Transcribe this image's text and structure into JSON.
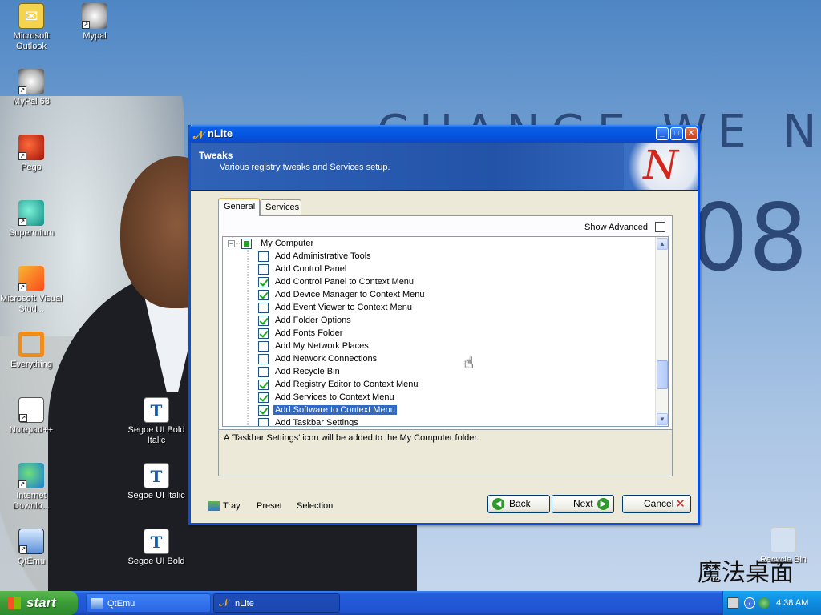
{
  "desktop": {
    "wallpaper_text": "CHANGE WE NEED",
    "wallpaper_year": "08",
    "brand_script": "魔法桌面",
    "icons_left": [
      {
        "label": "Microsoft Outlook",
        "icon": "outlook-icon"
      },
      {
        "label": "MyPal 68",
        "icon": "mypal-icon"
      },
      {
        "label": "Pego",
        "icon": "pego-icon"
      },
      {
        "label": "Supermium",
        "icon": "supermium-icon"
      },
      {
        "label": "Microsoft Visual Stud...",
        "icon": "visual-studio-icon"
      },
      {
        "label": "Everything",
        "icon": "everything-icon"
      },
      {
        "label": "Notepad++",
        "icon": "notepad-plus-plus-icon"
      },
      {
        "label": "Internet Downlo...",
        "icon": "idm-icon"
      },
      {
        "label": "QtEmu",
        "icon": "qtemu-icon"
      }
    ],
    "icons_second": [
      {
        "label": "Mypal",
        "icon": "mypal-icon"
      },
      {
        "label": "Segoe UI Bold Italic",
        "icon": "font-file-icon"
      },
      {
        "label": "Segoe UI Italic",
        "icon": "font-file-icon"
      },
      {
        "label": "Segoe UI Bold",
        "icon": "font-file-icon"
      }
    ],
    "recycle_bin": {
      "label": "Recycle Bin",
      "icon": "recycle-bin-icon"
    }
  },
  "window": {
    "title": "nLite",
    "header_title": "Tweaks",
    "header_subtitle": "Various registry tweaks and Services setup.",
    "tabs": [
      {
        "label": "General",
        "active": true
      },
      {
        "label": "Services",
        "active": false
      }
    ],
    "show_advanced": {
      "label": "Show Advanced",
      "checked": false
    },
    "tree": {
      "root": {
        "label": "My Computer",
        "state": "partial",
        "expanded": true
      },
      "items": [
        {
          "label": "Add Administrative Tools",
          "checked": false,
          "selected": false
        },
        {
          "label": "Add Control Panel",
          "checked": false,
          "selected": false
        },
        {
          "label": "Add Control Panel to Context Menu",
          "checked": true,
          "selected": false
        },
        {
          "label": "Add Device Manager to Context Menu",
          "checked": true,
          "selected": false
        },
        {
          "label": "Add Event Viewer to Context Menu",
          "checked": false,
          "selected": false
        },
        {
          "label": "Add Folder Options",
          "checked": true,
          "selected": false
        },
        {
          "label": "Add Fonts Folder",
          "checked": true,
          "selected": false
        },
        {
          "label": "Add My Network Places",
          "checked": false,
          "selected": false
        },
        {
          "label": "Add Network Connections",
          "checked": false,
          "selected": false
        },
        {
          "label": "Add Recycle Bin",
          "checked": false,
          "selected": false
        },
        {
          "label": "Add Registry Editor to Context Menu",
          "checked": true,
          "selected": false
        },
        {
          "label": "Add Services to Context Menu",
          "checked": true,
          "selected": false
        },
        {
          "label": "Add Software to Context Menu",
          "checked": true,
          "selected": true
        },
        {
          "label": "Add Taskbar Settings",
          "checked": false,
          "selected": false
        }
      ]
    },
    "description": "A 'Taskbar Settings' icon will be added to the My Computer folder.",
    "bottom_links": {
      "tray": "Tray",
      "preset": "Preset",
      "selection": "Selection"
    },
    "buttons": {
      "back": "Back",
      "next": "Next",
      "cancel": "Cancel"
    }
  },
  "taskbar": {
    "start_label": "start",
    "tasks": [
      {
        "label": "QtEmu",
        "icon": "qtemu-icon",
        "active": false
      },
      {
        "label": "nLite",
        "icon": "nlite-icon",
        "active": true
      }
    ],
    "clock": "4:38 AM"
  }
}
